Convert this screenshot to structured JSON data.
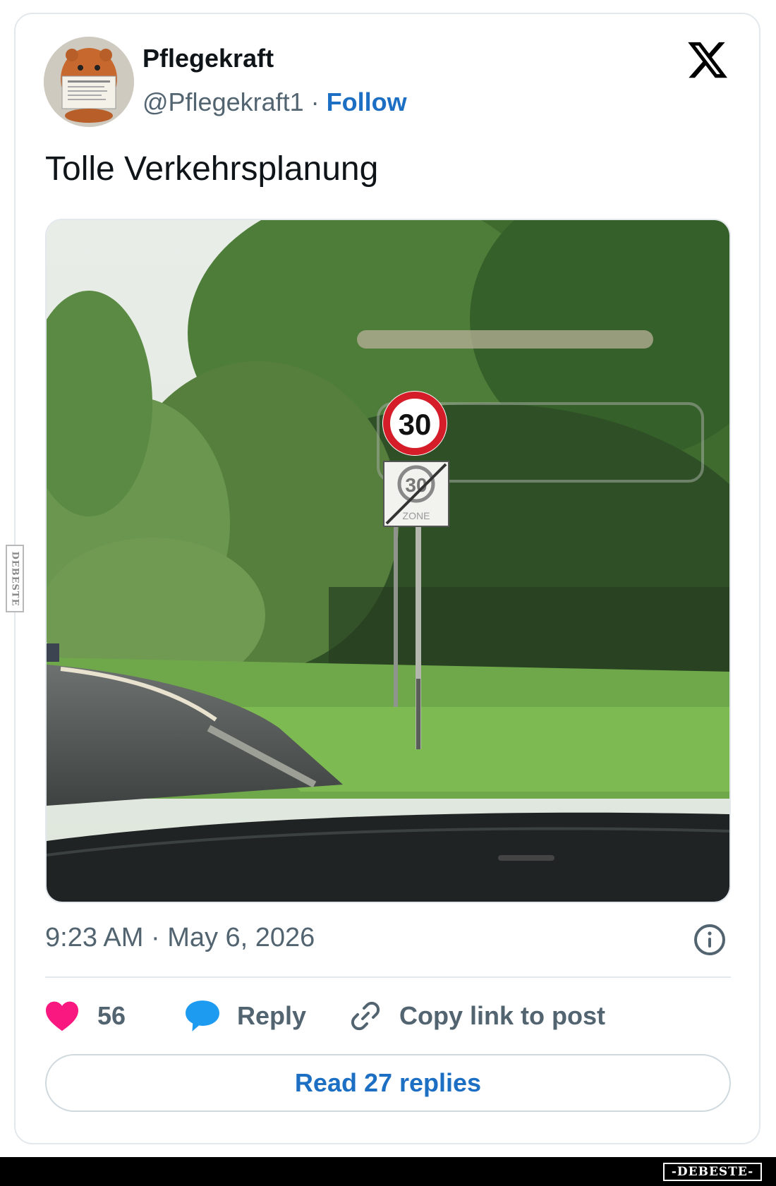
{
  "tweet": {
    "author_name": "Pflegekraft",
    "handle": "@Pflegekraft1",
    "separator": " · ",
    "follow_label": "Follow",
    "text": "Tolle Verkehrsplanung",
    "timestamp": "9:23 AM · May 6, 2026"
  },
  "media": {
    "sign_speed": "30",
    "sign_zone_speed": "30",
    "sign_zone_label": "ZONE"
  },
  "actions": {
    "like_count": "56",
    "reply_label": "Reply",
    "copy_link_label": "Copy link to post",
    "read_replies_label": "Read 27 replies"
  },
  "icons": {
    "logo": "x-logo-icon",
    "info": "info-icon",
    "like": "heart-icon",
    "reply": "speech-bubble-icon",
    "copy": "link-icon"
  },
  "colors": {
    "like": "#f91880",
    "reply": "#1d9bf0",
    "link": "#1d6fc4",
    "muted": "#536471"
  },
  "watermark": {
    "side": "DEBESTE",
    "bottom": "-DEBESTE-"
  }
}
